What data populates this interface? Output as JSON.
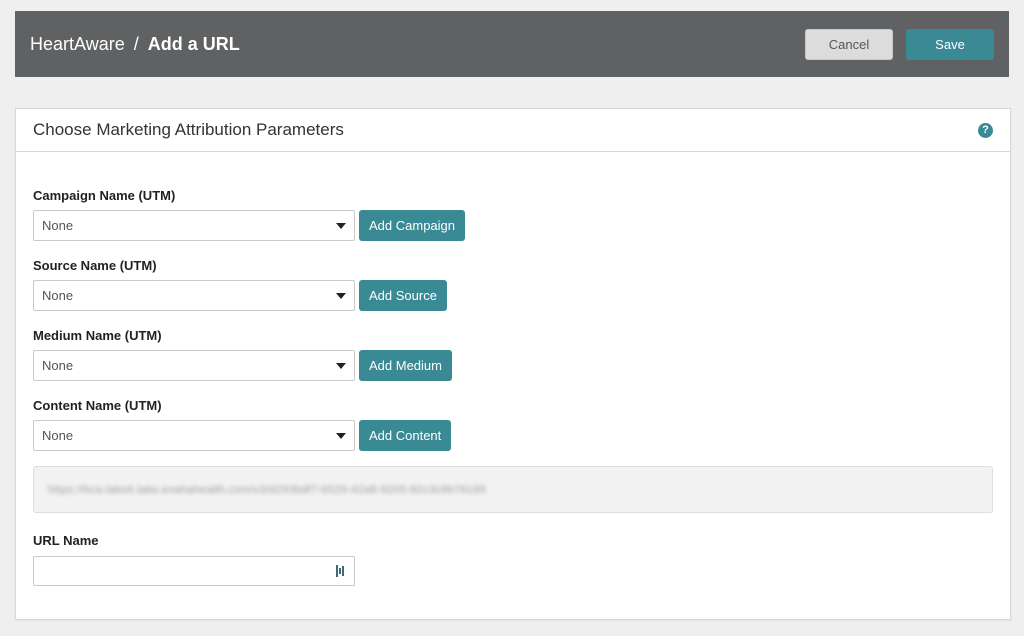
{
  "header": {
    "app_name": "HeartAware",
    "separator": "/",
    "title": "Add a URL",
    "cancel_label": "Cancel",
    "save_label": "Save"
  },
  "panel": {
    "title": "Choose Marketing Attribution Parameters",
    "help_icon": "question-circle-icon",
    "help_glyph": "?"
  },
  "fields": {
    "campaign": {
      "label": "Campaign Name (UTM)",
      "value": "None",
      "button": "Add Campaign"
    },
    "source": {
      "label": "Source Name (UTM)",
      "value": "None",
      "button": "Add Source"
    },
    "medium": {
      "label": "Medium Name (UTM)",
      "value": "None",
      "button": "Add Medium"
    },
    "content": {
      "label": "Content Name (UTM)",
      "value": "None",
      "button": "Add Content"
    }
  },
  "generated_url": "https://hca-labs6.labs.evahahealth.com/v3/d293bdf7-b529-42a8-9205-82c3c6b76169",
  "url_name": {
    "label": "URL Name",
    "value": ""
  },
  "colors": {
    "topbar": "#5f6163",
    "accent": "#3a8a95",
    "background": "#efefef"
  }
}
